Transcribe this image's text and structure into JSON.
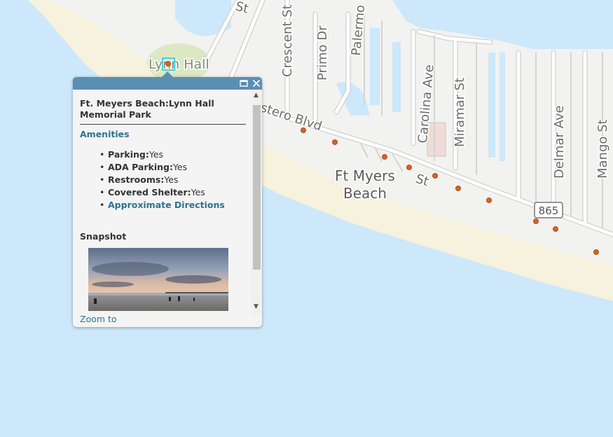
{
  "map": {
    "labels": {
      "park": "Lynn Hall",
      "st_top": "St",
      "crescent": "Crescent St",
      "primo": "Primo Dr",
      "palermo": "Palermo Cir",
      "carolina": "Carolina Ave",
      "miramar": "Miramar St",
      "delmar": "Delmar Ave",
      "mango": "Mango St",
      "estero": "Estero Blvd",
      "town_line1": "Ft Myers",
      "town_line2": "Beach",
      "highway": "865",
      "st_small": "St"
    },
    "colors": {
      "water": "#cce8fa",
      "land": "#f2f2f0",
      "sand": "#f6f2dd",
      "park": "#dce8c4",
      "road": "#ffffff",
      "road_outline": "#c7c7c7",
      "poi": "#e0601e",
      "selection": "#4fd1d6"
    }
  },
  "popup": {
    "title": "Ft. Meyers Beach:Lynn Hall Memorial Park",
    "section_amenities": "Amenities",
    "amenities": [
      {
        "key": "Parking:",
        "value": "Yes"
      },
      {
        "key": "ADA Parking:",
        "value": "Yes"
      },
      {
        "key": "Restrooms:",
        "value": "Yes"
      },
      {
        "key": "Covered Shelter:",
        "value": "Yes"
      }
    ],
    "directions_link": "Approximate Directions",
    "section_snapshot": "Snapshot",
    "zoom_link": "Zoom to",
    "header_color": "#5a8fb4",
    "link_color": "#2e7290"
  },
  "icons": [
    "maximize-icon",
    "close-icon",
    "scroll-up-icon",
    "scroll-down-icon"
  ]
}
